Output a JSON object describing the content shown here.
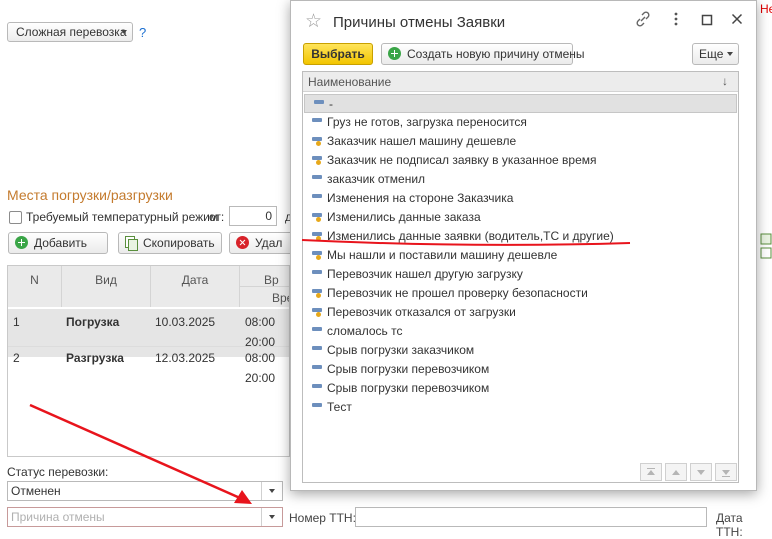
{
  "form": {
    "transport_type": "Сложная перевозка",
    "help_mark": "?",
    "corner_text": "Не",
    "section_title": "Места погрузки/разгрузки",
    "temp_regime_label": "Требуемый температурный режим",
    "temp_from_label": "от:",
    "temp_from_value": "0",
    "temp_to_label": "д",
    "toolbar": {
      "add_label": "Добавить",
      "copy_label": "Скопировать",
      "delete_label": "Удал"
    },
    "table": {
      "columns": {
        "n": "N",
        "type": "Вид",
        "date": "Дата",
        "time": "Вр",
        "time_sub": "Врем"
      },
      "rows": [
        {
          "n": "1",
          "type": "Погрузка",
          "date": "10.03.2025",
          "time_from": "08:00",
          "time_to": "20:00"
        },
        {
          "n": "2",
          "type": "Разгрузка",
          "date": "12.03.2025",
          "time_from": "08:00",
          "time_to": "20:00"
        }
      ]
    },
    "status_label": "Статус перевозки:",
    "status_value": "Отменен",
    "cancel_reason_placeholder": "Причина отмены",
    "ttn_label": "Номер ТТН:",
    "ttn_value": "",
    "ttn_date_label": "Дата ТТН:"
  },
  "dialog": {
    "title": "Причины отмены Заявки",
    "choose_label": "Выбрать",
    "create_label": "Создать новую причину отмены",
    "more_label": "Еще",
    "column_name": "Наименование",
    "sort_indicator": "↓",
    "items": [
      {
        "label": "-",
        "marked": false,
        "selected": true
      },
      {
        "label": "Груз не готов, загрузка переносится",
        "marked": false,
        "selected": false
      },
      {
        "label": "Заказчик нашел машину дешевле",
        "marked": true,
        "selected": false
      },
      {
        "label": "Заказчик не подписал заявку в указанное время",
        "marked": true,
        "selected": false
      },
      {
        "label": "заказчик отменил",
        "marked": false,
        "selected": false
      },
      {
        "label": "Изменения на стороне Заказчика",
        "marked": false,
        "selected": false
      },
      {
        "label": "Изменились данные заказа",
        "marked": true,
        "selected": false
      },
      {
        "label": "Изменились данные заявки (водитель,ТС и другие)",
        "marked": true,
        "selected": false
      },
      {
        "label": "Мы нашли и поставили машину дешевле",
        "marked": true,
        "selected": false
      },
      {
        "label": "Перевозчик нашел другую загрузку",
        "marked": false,
        "selected": false
      },
      {
        "label": "Перевозчик не прошел проверку безопасности",
        "marked": true,
        "selected": false
      },
      {
        "label": "Перевозчик отказался от загрузки",
        "marked": true,
        "selected": false
      },
      {
        "label": "сломалось тс",
        "marked": false,
        "selected": false
      },
      {
        "label": "Срыв погрузки заказчиком",
        "marked": false,
        "selected": false
      },
      {
        "label": "Срыв погрузки перевозчиком",
        "marked": false,
        "selected": false
      },
      {
        "label": "Срыв погрузки перевозчиком",
        "marked": false,
        "selected": false
      },
      {
        "label": "Тест",
        "marked": false,
        "selected": false
      }
    ]
  },
  "colors": {
    "accent_yellow": "#f2c500",
    "annotation_red": "#e8141c",
    "section_orange": "#c47b2e",
    "link_blue": "#1b6fd1"
  },
  "icons": {
    "favorite": "star-icon",
    "link": "link-icon",
    "menu": "more-vertical-icon",
    "maximize": "maximize-icon",
    "close": "close-icon"
  }
}
